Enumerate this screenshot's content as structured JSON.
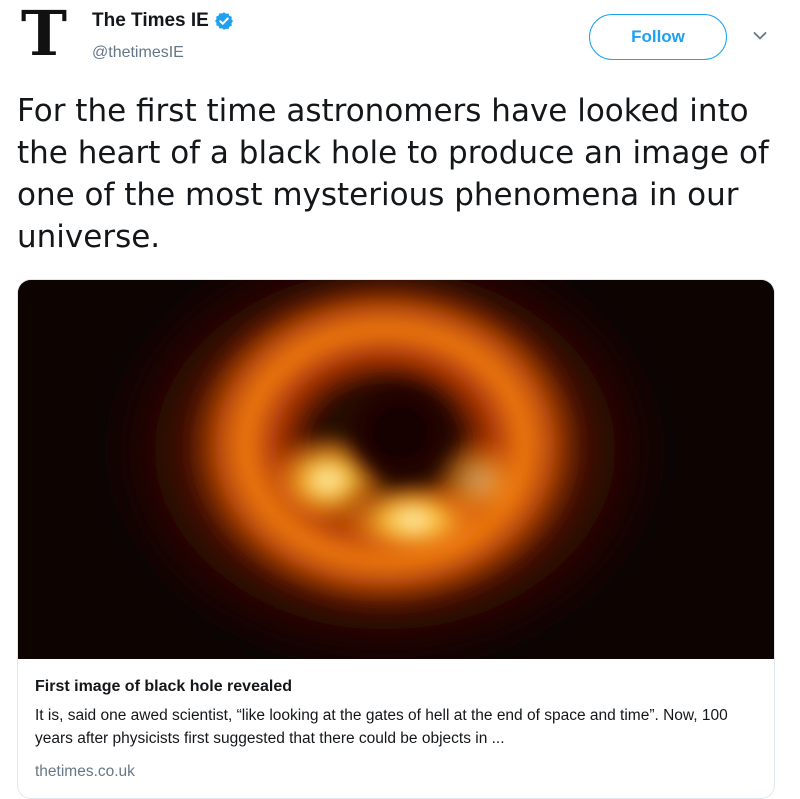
{
  "account": {
    "logo_letter": "T",
    "display_name": "The Times IE",
    "handle": "@thetimesIE",
    "verified_icon": "verified-badge-icon"
  },
  "actions": {
    "follow_label": "Follow",
    "menu_icon": "chevron-down-icon"
  },
  "tweet": {
    "text": "For the first time astronomers have looked into the heart of a black hole to produce an image of one of the most mysterious phenomena in our universe."
  },
  "card": {
    "title": "First image of black hole revealed",
    "description": "It is, said one awed scientist, “like looking at the gates of hell at the end of space and time”. Now, 100 years after physicists first suggested that there could be objects in ...",
    "domain": "thetimes.co.uk"
  },
  "colors": {
    "accent": "#1da1f2",
    "text": "#14171a",
    "muted": "#657786",
    "border": "#e1e8ed"
  }
}
